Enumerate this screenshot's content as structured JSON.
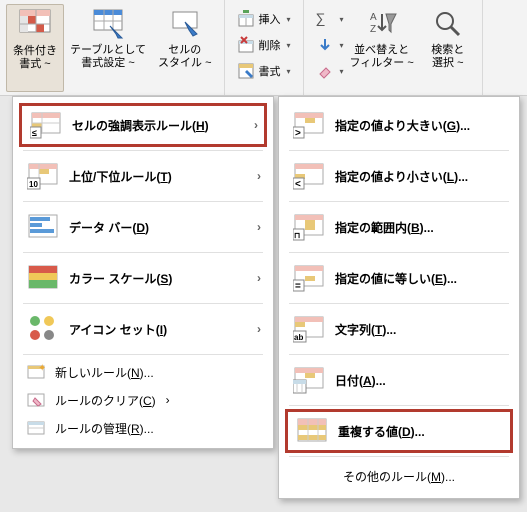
{
  "ribbon": {
    "cond_fmt": "条件付き\n書式 ~",
    "as_table": "テーブルとして\n書式設定 ~",
    "cell_styles": "セルの\nスタイル ~",
    "insert": "挿入",
    "delete": "削除",
    "format": "書式",
    "sort_filter": "並べ替えと\nフィルター ~",
    "find_select": "検索と\n選択 ~"
  },
  "menu1": {
    "highlight_rules": "セルの強調表示ルール(H)",
    "top_bottom": "上位/下位ルール(T)",
    "data_bars": "データ バー(D)",
    "color_scales": "カラー スケール(S)",
    "icon_sets": "アイコン セット(I)",
    "new_rule": "新しいルール(N)...",
    "clear_rules": "ルールのクリア(C)",
    "manage_rules": "ルールの管理(R)..."
  },
  "menu2": {
    "greater": "指定の値より大きい(G)...",
    "less": "指定の値より小さい(L)...",
    "between": "指定の範囲内(B)...",
    "equal": "指定の値に等しい(E)...",
    "text": "文字列(T)...",
    "date": "日付(A)...",
    "duplicate": "重複する値(D)...",
    "more": "その他のルール(M)..."
  }
}
